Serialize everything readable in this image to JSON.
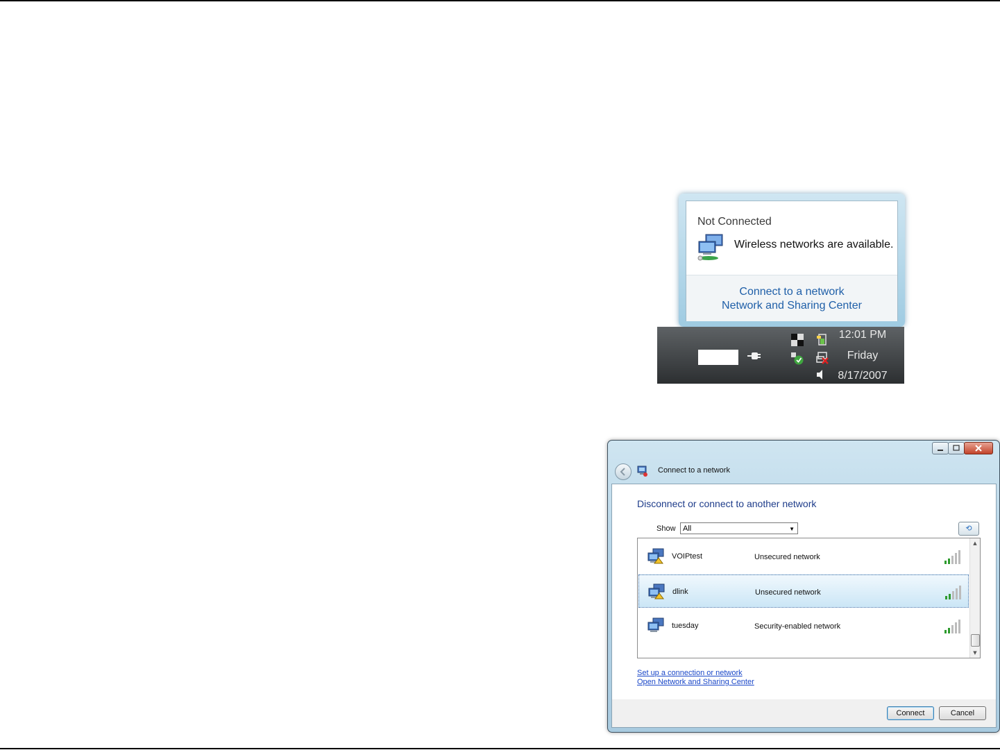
{
  "balloon": {
    "title": "Not Connected",
    "message": "Wireless networks are available.",
    "links": [
      "Connect to a network",
      "Network and Sharing Center"
    ]
  },
  "taskbar": {
    "time": "12:01 PM",
    "day": "Friday",
    "date": "8/17/2007"
  },
  "dialog": {
    "title": "Connect to a network",
    "heading": "Disconnect or connect to another network",
    "show_label": "Show",
    "show_value": "All",
    "networks": [
      {
        "name": "VOIPtest",
        "status": "Unsecured network",
        "signal_bars": 5,
        "selected": false
      },
      {
        "name": "dlink",
        "status": "Unsecured network",
        "signal_bars": 5,
        "selected": true
      },
      {
        "name": "tuesday",
        "status": "Security-enabled network",
        "signal_bars": 5,
        "selected": false
      }
    ],
    "links": [
      "Set up a connection or network",
      "Open Network and Sharing Center"
    ],
    "connect_label": "Connect",
    "cancel_label": "Cancel"
  },
  "icons": {
    "network": "network-computers-icon",
    "plug": "power-plug-icon",
    "refresh": "refresh-icon",
    "signal": "signal-strength-icon"
  },
  "colors": {
    "link": "#1f5fa8",
    "heading": "#1e3c8a",
    "selection": "#cbe6f6",
    "signal_green": "#2e9b2e"
  }
}
